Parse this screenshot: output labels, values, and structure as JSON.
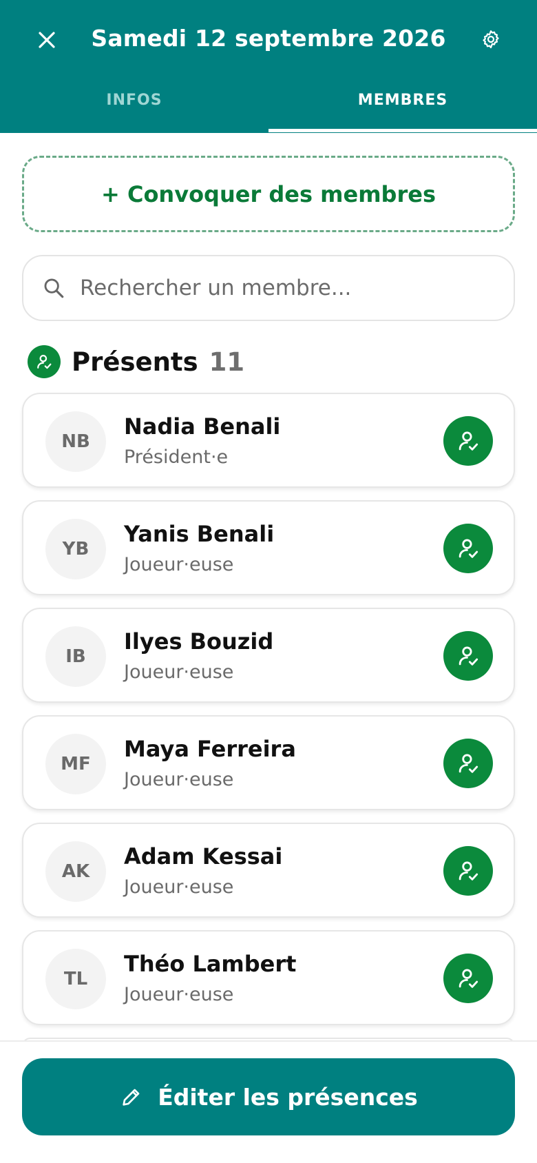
{
  "header": {
    "title": "Samedi 12 septembre 2026",
    "close_icon": "close-icon",
    "settings_icon": "gear-icon",
    "tabs": [
      {
        "label": "INFOS",
        "active": false
      },
      {
        "label": "MEMBRES",
        "active": true
      }
    ]
  },
  "convoke": {
    "label": "+ Convoquer des membres"
  },
  "search": {
    "placeholder": "Rechercher un membre..."
  },
  "present_section": {
    "title": "Présents",
    "count": "11"
  },
  "members": [
    {
      "initials": "NB",
      "name": "Nadia Benali",
      "role": "Président·e"
    },
    {
      "initials": "YB",
      "name": "Yanis Benali",
      "role": "Joueur·euse"
    },
    {
      "initials": "IB",
      "name": "Ilyes Bouzid",
      "role": "Joueur·euse"
    },
    {
      "initials": "MF",
      "name": "Maya Ferreira",
      "role": "Joueur·euse"
    },
    {
      "initials": "AK",
      "name": "Adam Kessai",
      "role": "Joueur·euse"
    },
    {
      "initials": "TL",
      "name": "Théo Lambert",
      "role": "Joueur·euse"
    }
  ],
  "footer": {
    "edit_label": "Éditer les présences",
    "edit_icon": "pencil-icon"
  },
  "colors": {
    "primary": "#008080",
    "success": "#0b8a3c",
    "accent_text": "#0a7a38"
  }
}
